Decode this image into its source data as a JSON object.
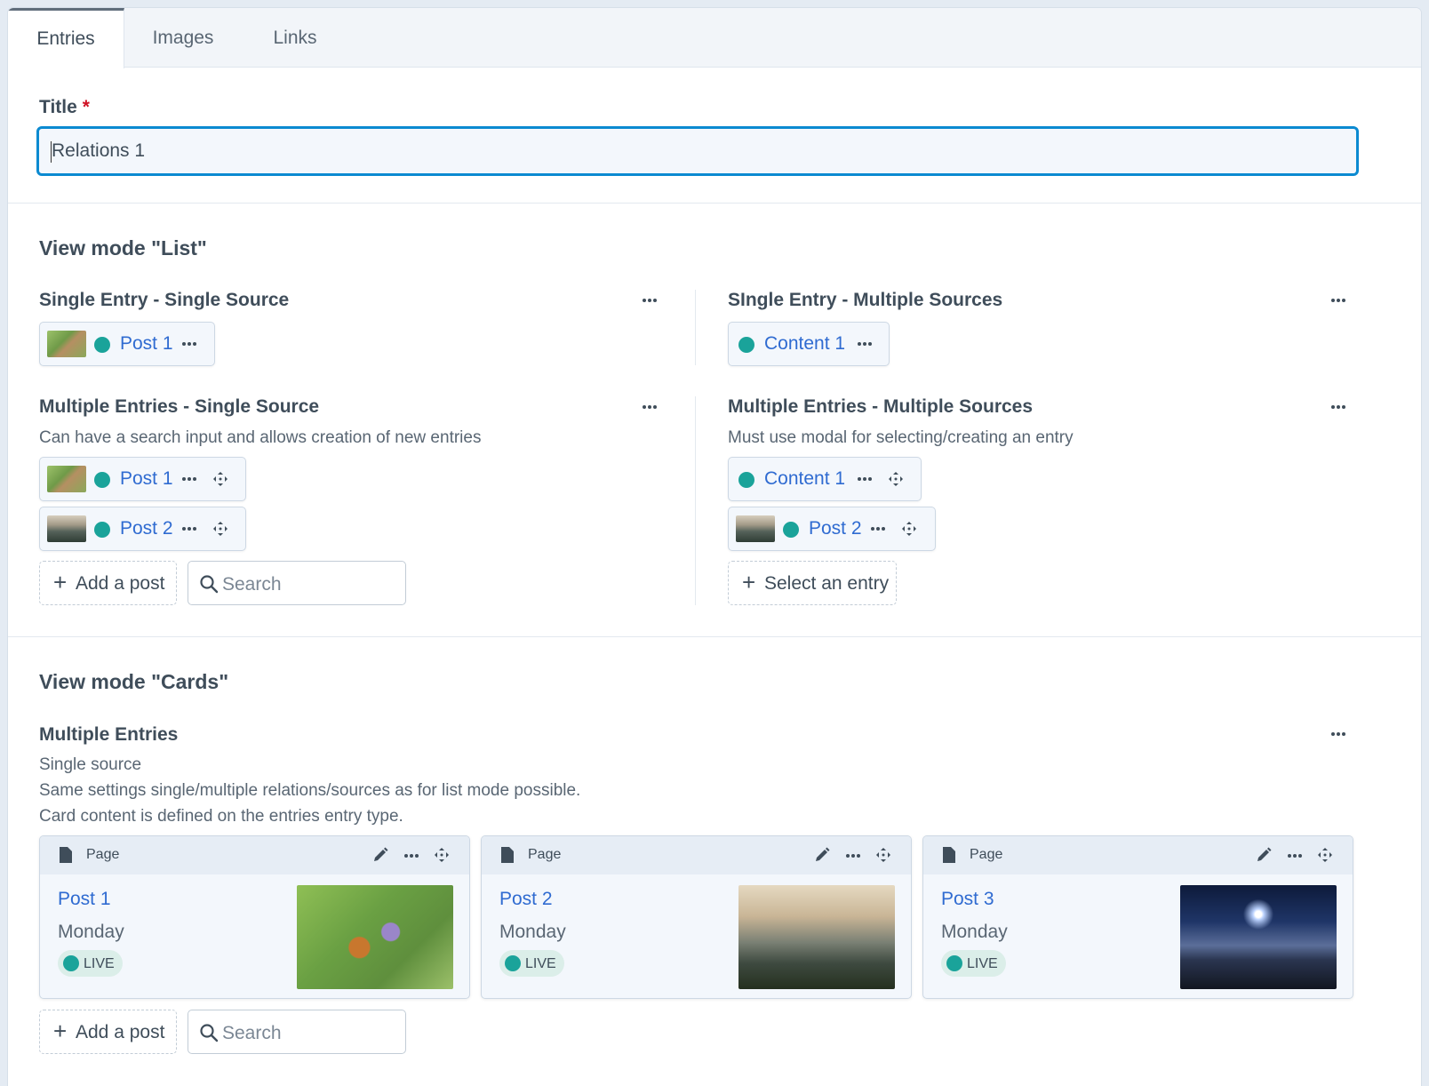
{
  "tabs": [
    {
      "label": "Entries"
    },
    {
      "label": "Images"
    },
    {
      "label": "Links"
    }
  ],
  "title_field": {
    "label": "Title",
    "required_mark": "*",
    "value": "Relations 1"
  },
  "list_section": {
    "heading": "View mode \"List\"",
    "single_single": {
      "label": "Single Entry - Single Source",
      "items": [
        {
          "label": "Post 1",
          "thumb": "flower"
        }
      ]
    },
    "single_multiple": {
      "label": "SIngle Entry - Multiple Sources",
      "items": [
        {
          "label": "Content 1"
        }
      ]
    },
    "multiple_single": {
      "label": "Multiple Entries - Single Source",
      "description": "Can have a search input and allows creation of new entries",
      "items": [
        {
          "label": "Post 1",
          "thumb": "flower"
        },
        {
          "label": "Post 2",
          "thumb": "mountain"
        }
      ],
      "add_label": "Add a post",
      "search_placeholder": "Search"
    },
    "multiple_multiple": {
      "label": "Multiple Entries - Multiple Sources",
      "description": "Must use modal for selecting/creating an entry",
      "items": [
        {
          "label": "Content 1"
        },
        {
          "label": "Post 2",
          "thumb": "mountain"
        }
      ],
      "select_label": "Select an entry"
    }
  },
  "cards_section": {
    "heading": "View mode \"Cards\"",
    "field_label": "Multiple Entries",
    "description_lines": [
      "Single source",
      "Same settings single/multiple relations/sources as for list mode possible.",
      "Card content is defined on the entries entry type."
    ],
    "cards": [
      {
        "type": "Page",
        "title": "Post 1",
        "day": "Monday",
        "status": "LIVE"
      },
      {
        "type": "Page",
        "title": "Post 2",
        "day": "Monday",
        "status": "LIVE"
      },
      {
        "type": "Page",
        "title": "Post 3",
        "day": "Monday",
        "status": "LIVE"
      }
    ],
    "add_label": "Add a post",
    "search_placeholder": "Search"
  },
  "colors": {
    "accent": "#0b8ad1",
    "link": "#2f6bd1",
    "live": "#1aa39a",
    "required": "#cf1124"
  },
  "icons": [
    "ellipsis-icon",
    "move-icon",
    "plus-icon",
    "search-icon",
    "document-icon",
    "pencil-icon",
    "status-dot-icon"
  ]
}
